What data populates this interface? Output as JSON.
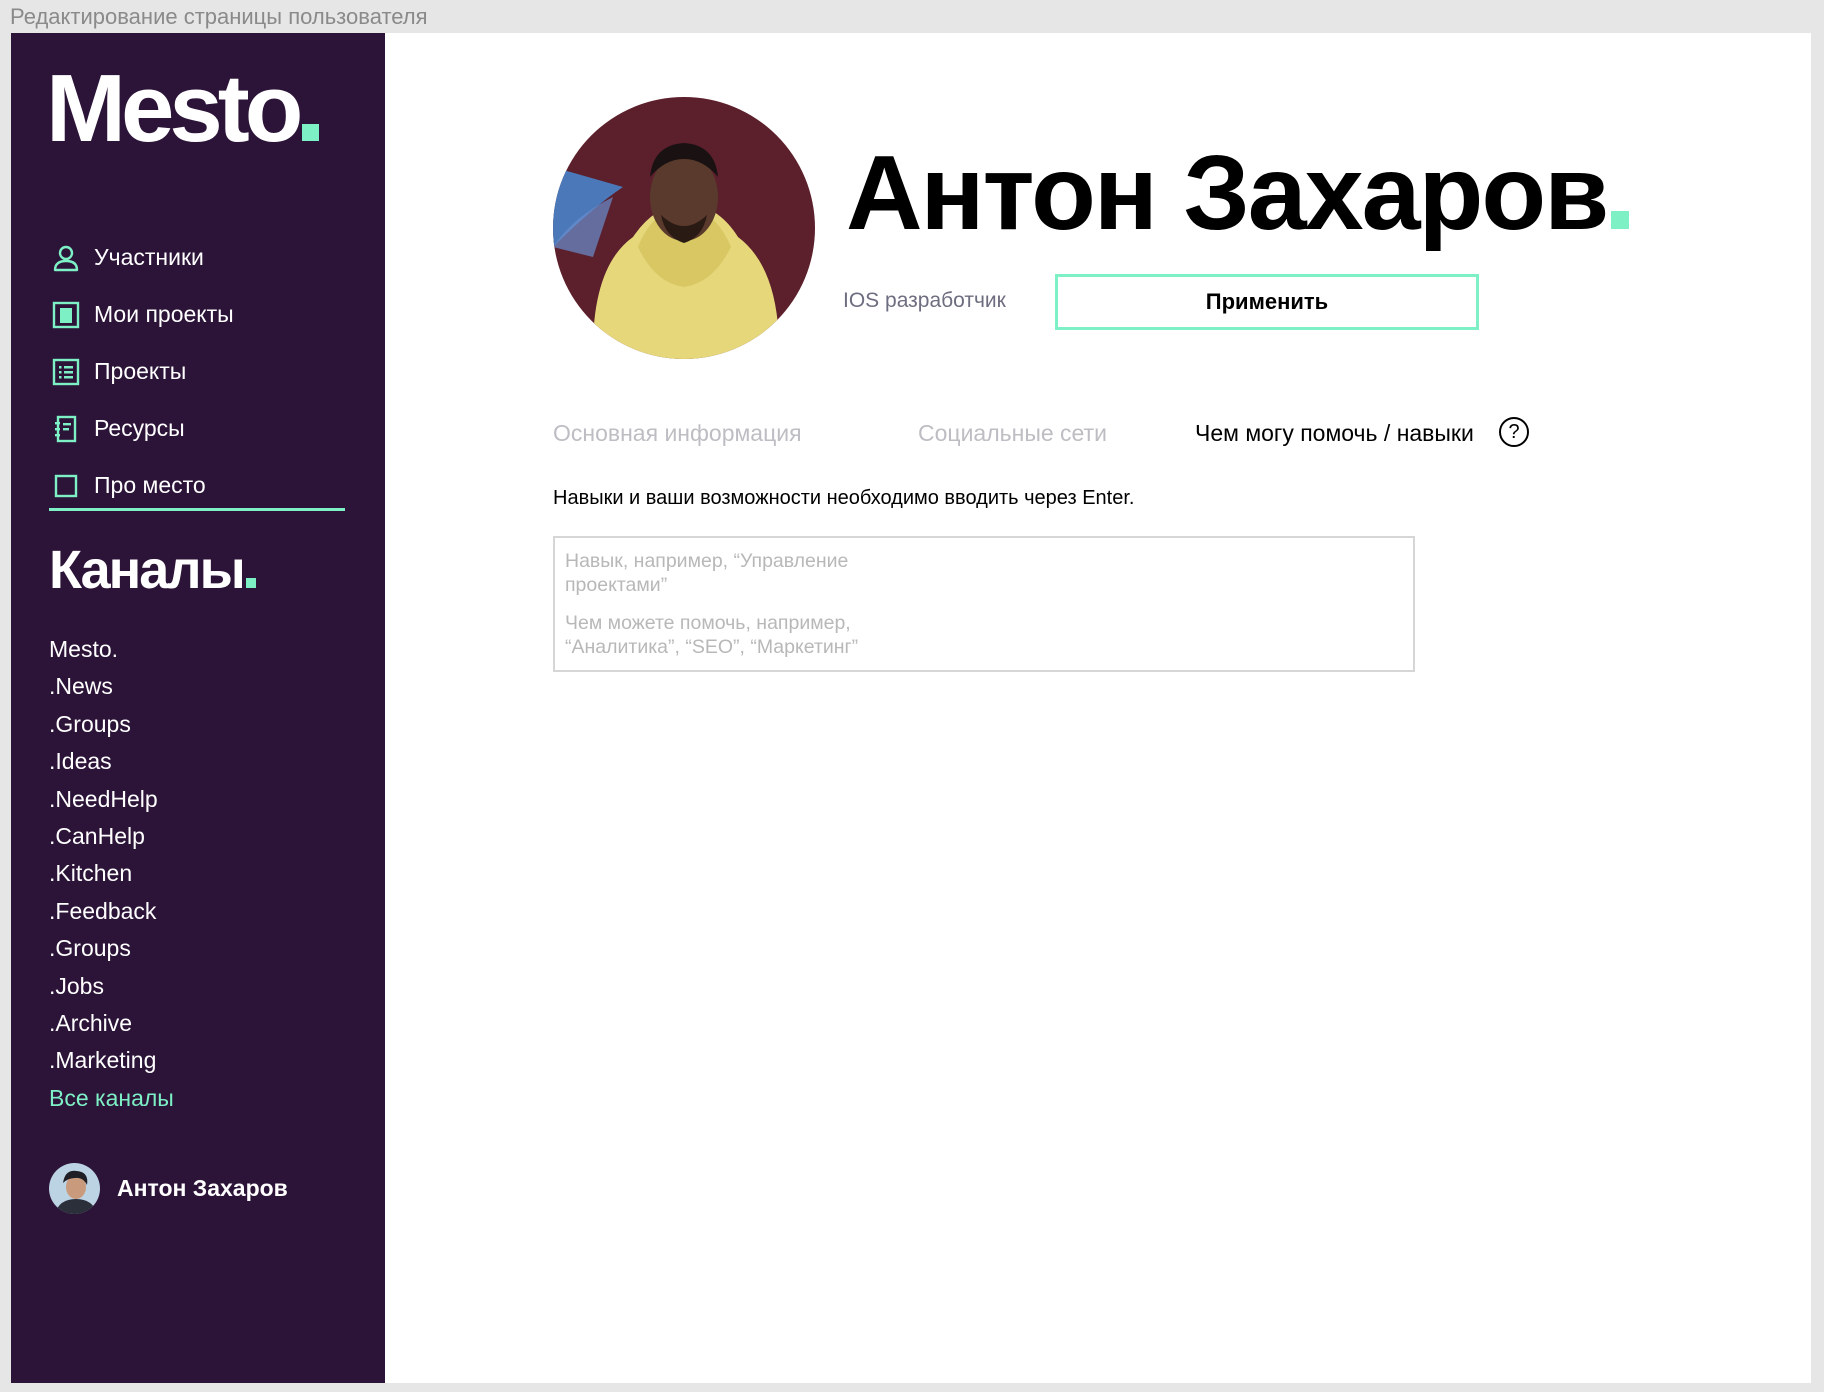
{
  "window": {
    "title": "Редактирование страницы пользователя"
  },
  "colors": {
    "sidebar_bg": "#2c1338",
    "accent": "#7df0c6",
    "role_text": "#6d6d80",
    "inactive_tab": "#bdbdc3"
  },
  "sidebar": {
    "logo": "Mesto",
    "nav": [
      {
        "label": "Участники",
        "icon": "user-icon"
      },
      {
        "label": "Мои проекты",
        "icon": "folder-icon"
      },
      {
        "label": "Проекты",
        "icon": "list-icon"
      },
      {
        "label": "Ресурсы",
        "icon": "notebook-icon"
      },
      {
        "label": "Про место",
        "icon": "square-icon"
      }
    ],
    "channels_title": "Каналы",
    "channels": [
      "Mesto.",
      ".News",
      ".Groups",
      ".Ideas",
      ".NeedHelp",
      ".CanHelp",
      ".Kitchen",
      ".Feedback",
      ".Groups",
      ".Jobs",
      ".Archive",
      ".Marketing"
    ],
    "all_channels": "Все каналы",
    "user": {
      "name": "Антон Захаров"
    }
  },
  "profile": {
    "name": "Антон Захаров",
    "role": "IOS разработчик",
    "apply_label": "Применить"
  },
  "tabs": [
    {
      "label": "Основная информация",
      "active": false
    },
    {
      "label": "Социальные сети",
      "active": false
    },
    {
      "label": "Чем могу помочь / навыки",
      "active": true
    }
  ],
  "help_icon_glyph": "?",
  "skills": {
    "hint": "Навыки и ваши возможности необходимо вводить через Enter.",
    "skill_placeholder": "Навык, например, “Управление проектами”",
    "help_placeholder": "Чем можете помочь, например, “Аналитика”, “SEO”, “Маркетинг”"
  }
}
